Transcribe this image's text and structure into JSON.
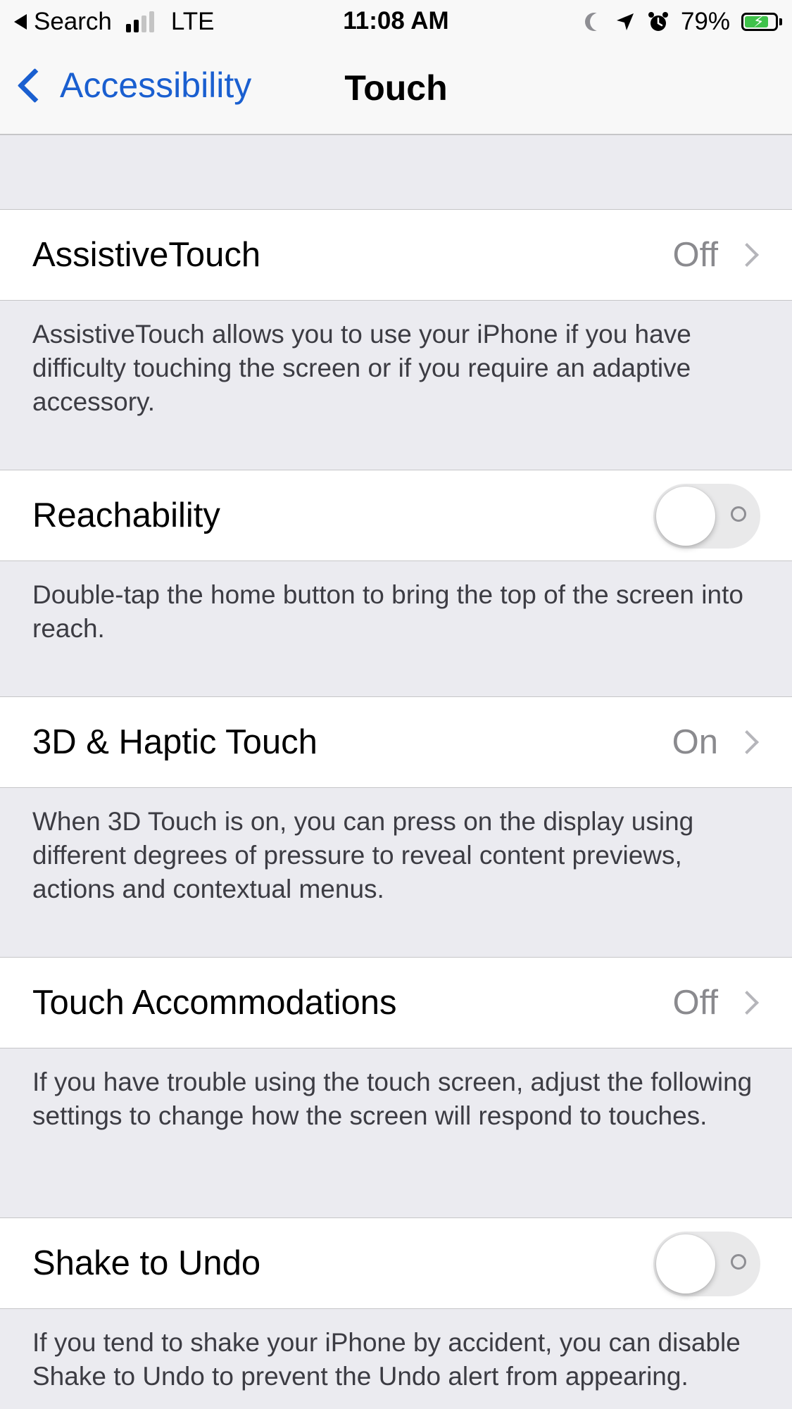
{
  "status_bar": {
    "back_app": "Search",
    "network": "LTE",
    "time": "11:08 AM",
    "battery": "79%",
    "battery_level": 0.79,
    "signal_bars_filled": 2,
    "signal_bars_total": 4
  },
  "nav": {
    "back_label": "Accessibility",
    "title": "Touch"
  },
  "rows": [
    {
      "label": "AssistiveTouch",
      "value": "Off",
      "footer": "AssistiveTouch allows you to use your iPhone if you have difficulty touching the screen or if you require an adaptive accessory."
    },
    {
      "label": "Reachability",
      "toggle_on": false,
      "footer": "Double-tap the home button to bring the top of the screen into reach."
    },
    {
      "label": "3D & Haptic Touch",
      "value": "On",
      "footer": "When 3D Touch is on, you can press on the display using different degrees of pressure to reveal content previews, actions and contextual menus."
    },
    {
      "label": "Touch Accommodations",
      "value": "Off",
      "footer": "If you have trouble using the touch screen, adjust the following settings to change how the screen will respond to touches."
    },
    {
      "label": "Shake to Undo",
      "toggle_on": false,
      "footer": "If you tend to shake your iPhone by accident, you can disable Shake to Undo to prevent the Undo alert from appearing."
    }
  ],
  "colors": {
    "accent": "#1a5fd0",
    "background": "#ebebf0",
    "battery_fill": "#3fc24a"
  }
}
